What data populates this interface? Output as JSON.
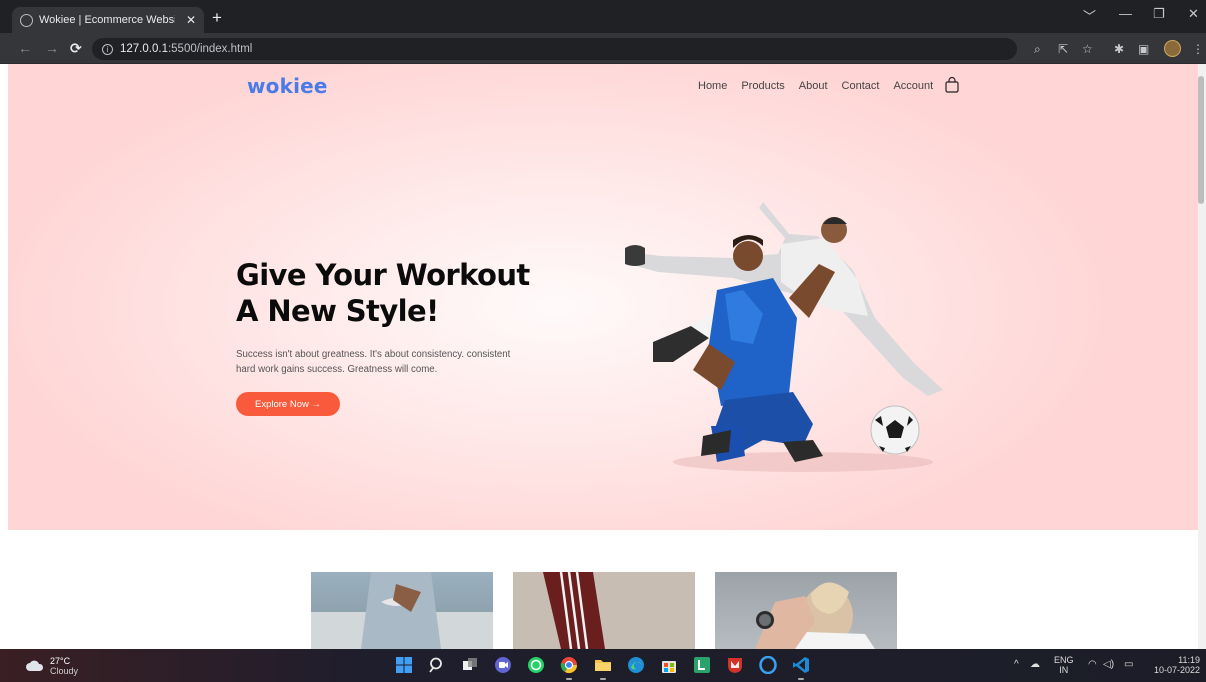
{
  "browser": {
    "tab_title": "Wokiee | Ecommerce Website de",
    "tab_close": "✕",
    "new_tab": "+",
    "url_host": "127.0.0.1",
    "url_path": ":5500/index.html",
    "window_controls": [
      "﹀",
      "—",
      "❐",
      "✕"
    ]
  },
  "site": {
    "logo": "wokiee",
    "nav": [
      "Home",
      "Products",
      "About",
      "Contact",
      "Account"
    ],
    "hero": {
      "headline_line1": "Give Your Workout",
      "headline_line2": "A New Style!",
      "subtext_line1": "Success isn't about greatness. It's about consistency. consistent",
      "subtext_line2": "hard work gains success. Greatness will come.",
      "cta": "Explore Now →"
    },
    "thumbnails": [
      "jeans-knees",
      "track-pants",
      "woman-smartwatch"
    ]
  },
  "taskbar": {
    "weather_temp": "27°C",
    "weather_cond": "Cloudy",
    "lang_top": "ENG",
    "lang_bottom": "IN",
    "time": "11:19",
    "date": "10-07-2022",
    "apps": [
      "start",
      "search",
      "task-view",
      "teams",
      "whatsapp",
      "chrome",
      "file-explorer",
      "edge",
      "store",
      "lucid",
      "mcafee",
      "opera",
      "vscode"
    ]
  },
  "colors": {
    "accent": "#4a7be6",
    "cta": "#fa5a3c",
    "hero_bg": "#ffd6d6"
  }
}
